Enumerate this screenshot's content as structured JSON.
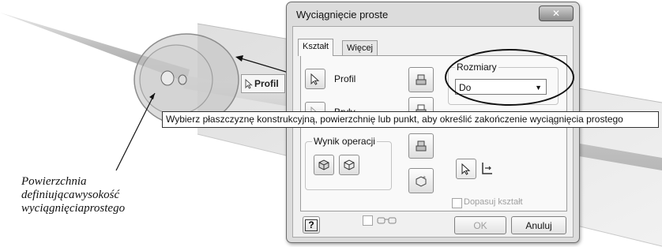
{
  "caption": {
    "line1": "Powierzchnia",
    "line2": "definiującawysokość",
    "line3": "wyciągnięciaprostego"
  },
  "profile_callout": {
    "label": "Profil"
  },
  "dialog": {
    "title": "Wyciągnięcie proste",
    "close_glyph": "✕",
    "tabs": [
      {
        "label": "Kształt",
        "active": true
      },
      {
        "label": "Więcej",
        "active": false
      }
    ],
    "profile_label": "Profil",
    "solids_label": "Bryły",
    "operation_group_label": "Wynik operacji",
    "dimensions_group_label": "Rozmiary",
    "dimensions_value": "Do",
    "match_shape_label": "Dopasuj kształt",
    "ok_label": "OK",
    "cancel_label": "Anuluj",
    "help_glyph": "?"
  },
  "tooltip": {
    "text": "Wybierz płaszczyznę konstrukcyjną, powierzchnię lub punkt, aby określić zakończenie wyciągnięcia prostego"
  },
  "icons": {
    "cursor": "cursor-arrow-icon",
    "extrude_target": "extrude-to-face-icon",
    "direction": "direction-icon",
    "solid": "solid-box-icon",
    "surface": "surface-box-icon",
    "help": "help-icon",
    "preview": "preview-glasses-icon"
  }
}
